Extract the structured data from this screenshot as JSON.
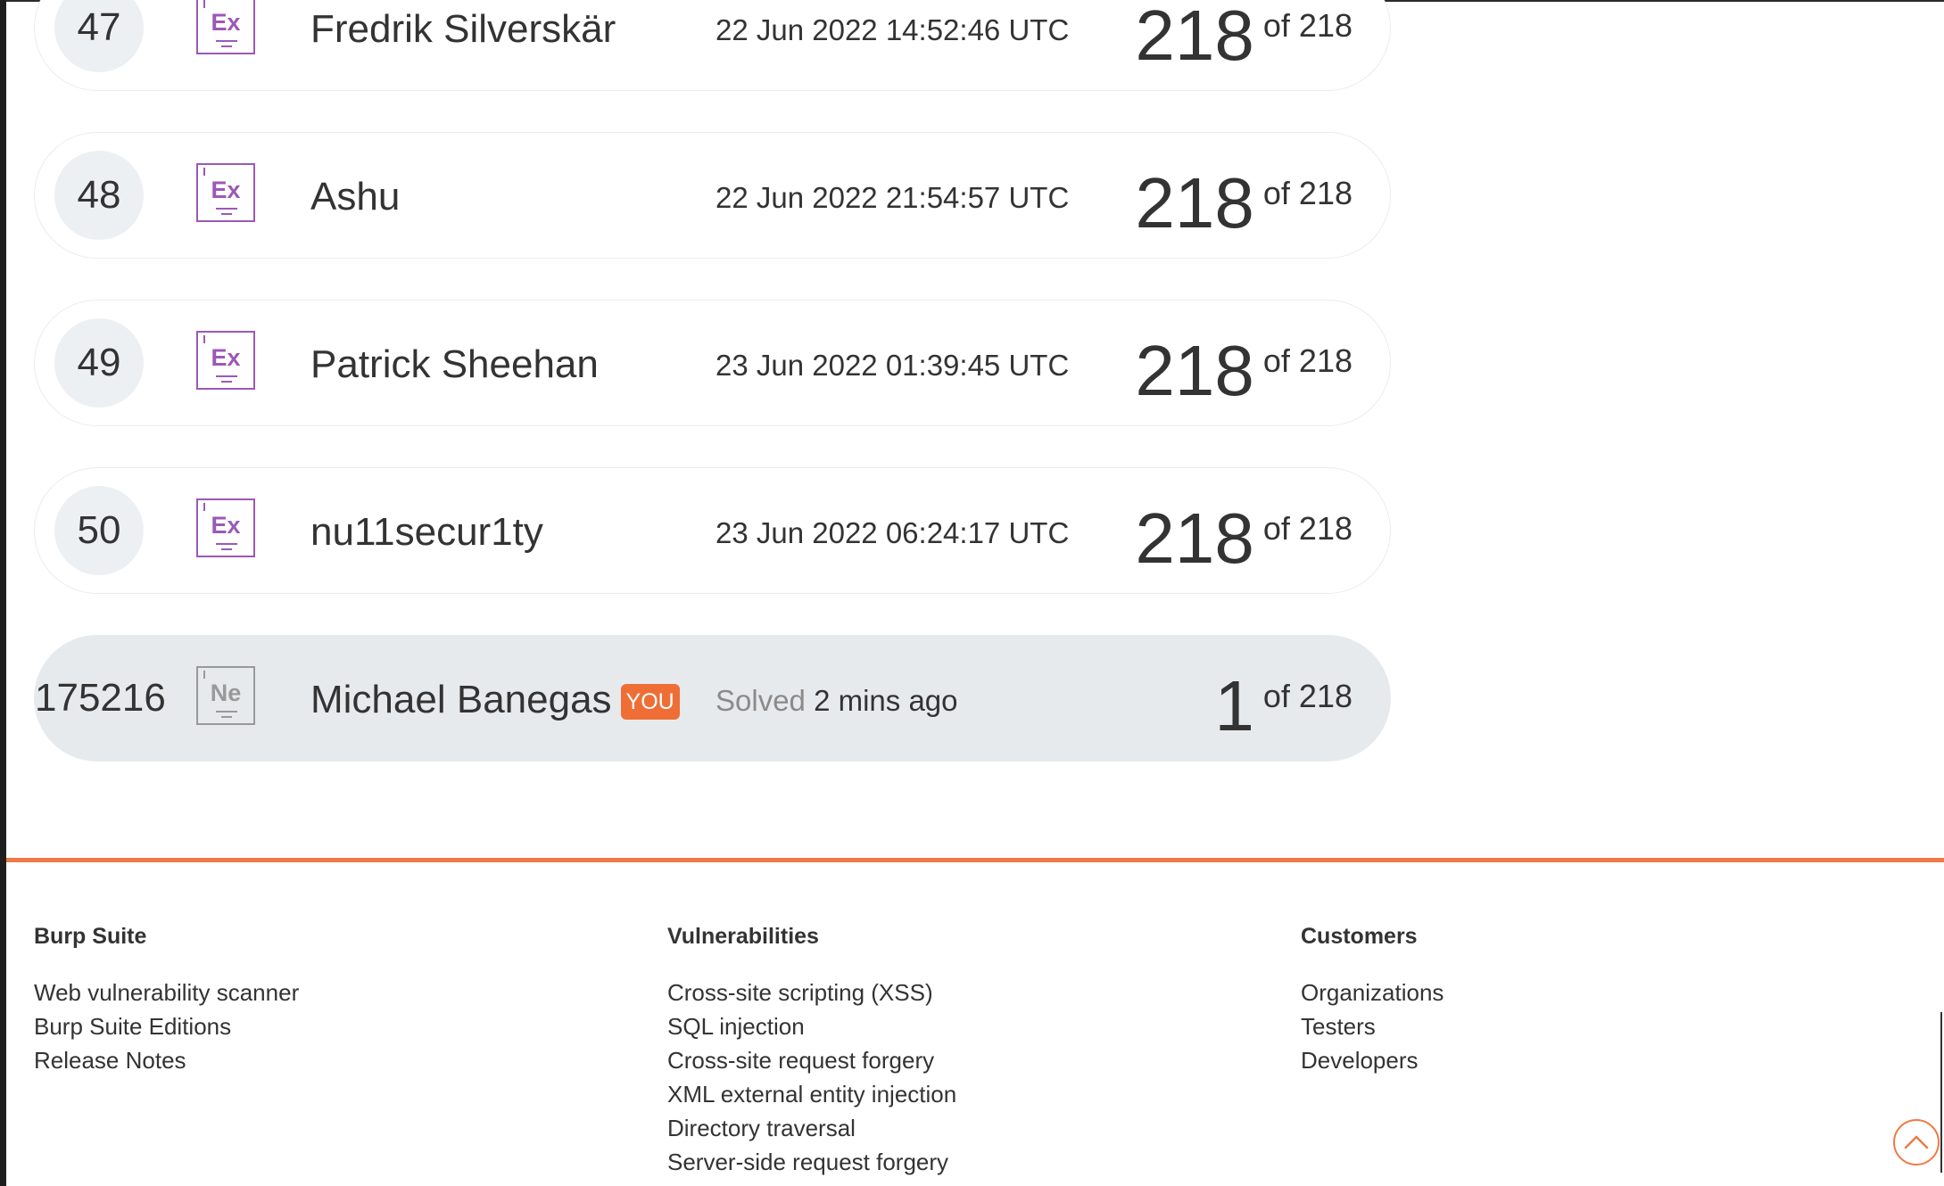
{
  "leaderboard": {
    "rows": [
      {
        "rank": "47",
        "badge": "Ex",
        "name": "Fredrik Silverskär",
        "date": "22 Jun 2022 14:52:46 UTC",
        "score": "218",
        "of": "of 218"
      },
      {
        "rank": "48",
        "badge": "Ex",
        "name": "Ashu",
        "date": "22 Jun 2022 21:54:57 UTC",
        "score": "218",
        "of": "of 218"
      },
      {
        "rank": "49",
        "badge": "Ex",
        "name": "Patrick Sheehan",
        "date": "23 Jun 2022 01:39:45 UTC",
        "score": "218",
        "of": "of 218"
      },
      {
        "rank": "50",
        "badge": "Ex",
        "name": "nu11secur1ty",
        "date": "23 Jun 2022 06:24:17 UTC",
        "score": "218",
        "of": "of 218"
      }
    ],
    "you_row": {
      "rank": "175216",
      "badge": "Ne",
      "name": "Michael Banegas",
      "you_tag": "YOU",
      "solved_label": "Solved",
      "solved_time": "2 mins ago",
      "score": "1",
      "of": "of 218"
    }
  },
  "footer": {
    "columns": [
      {
        "heading": "Burp Suite",
        "links": [
          "Web vulnerability scanner",
          "Burp Suite Editions",
          "Release Notes"
        ]
      },
      {
        "heading": "Vulnerabilities",
        "links": [
          "Cross-site scripting (XSS)",
          "SQL injection",
          "Cross-site request forgery",
          "XML external entity injection",
          "Directory traversal",
          "Server-side request forgery"
        ]
      },
      {
        "heading": "Customers",
        "links": [
          "Organizations",
          "Testers",
          "Developers"
        ]
      }
    ]
  },
  "colors": {
    "accent_orange": "#ef7a45",
    "you_tag": "#ef6e35",
    "expert_badge": "#9b59b6",
    "novice_badge": "#999999",
    "you_row_bg": "#e7eaed"
  },
  "icons": {
    "expert_badge": "expert-level-badge-icon",
    "novice_badge": "novice-level-badge-icon",
    "back_to_top": "chevron-up-icon"
  }
}
